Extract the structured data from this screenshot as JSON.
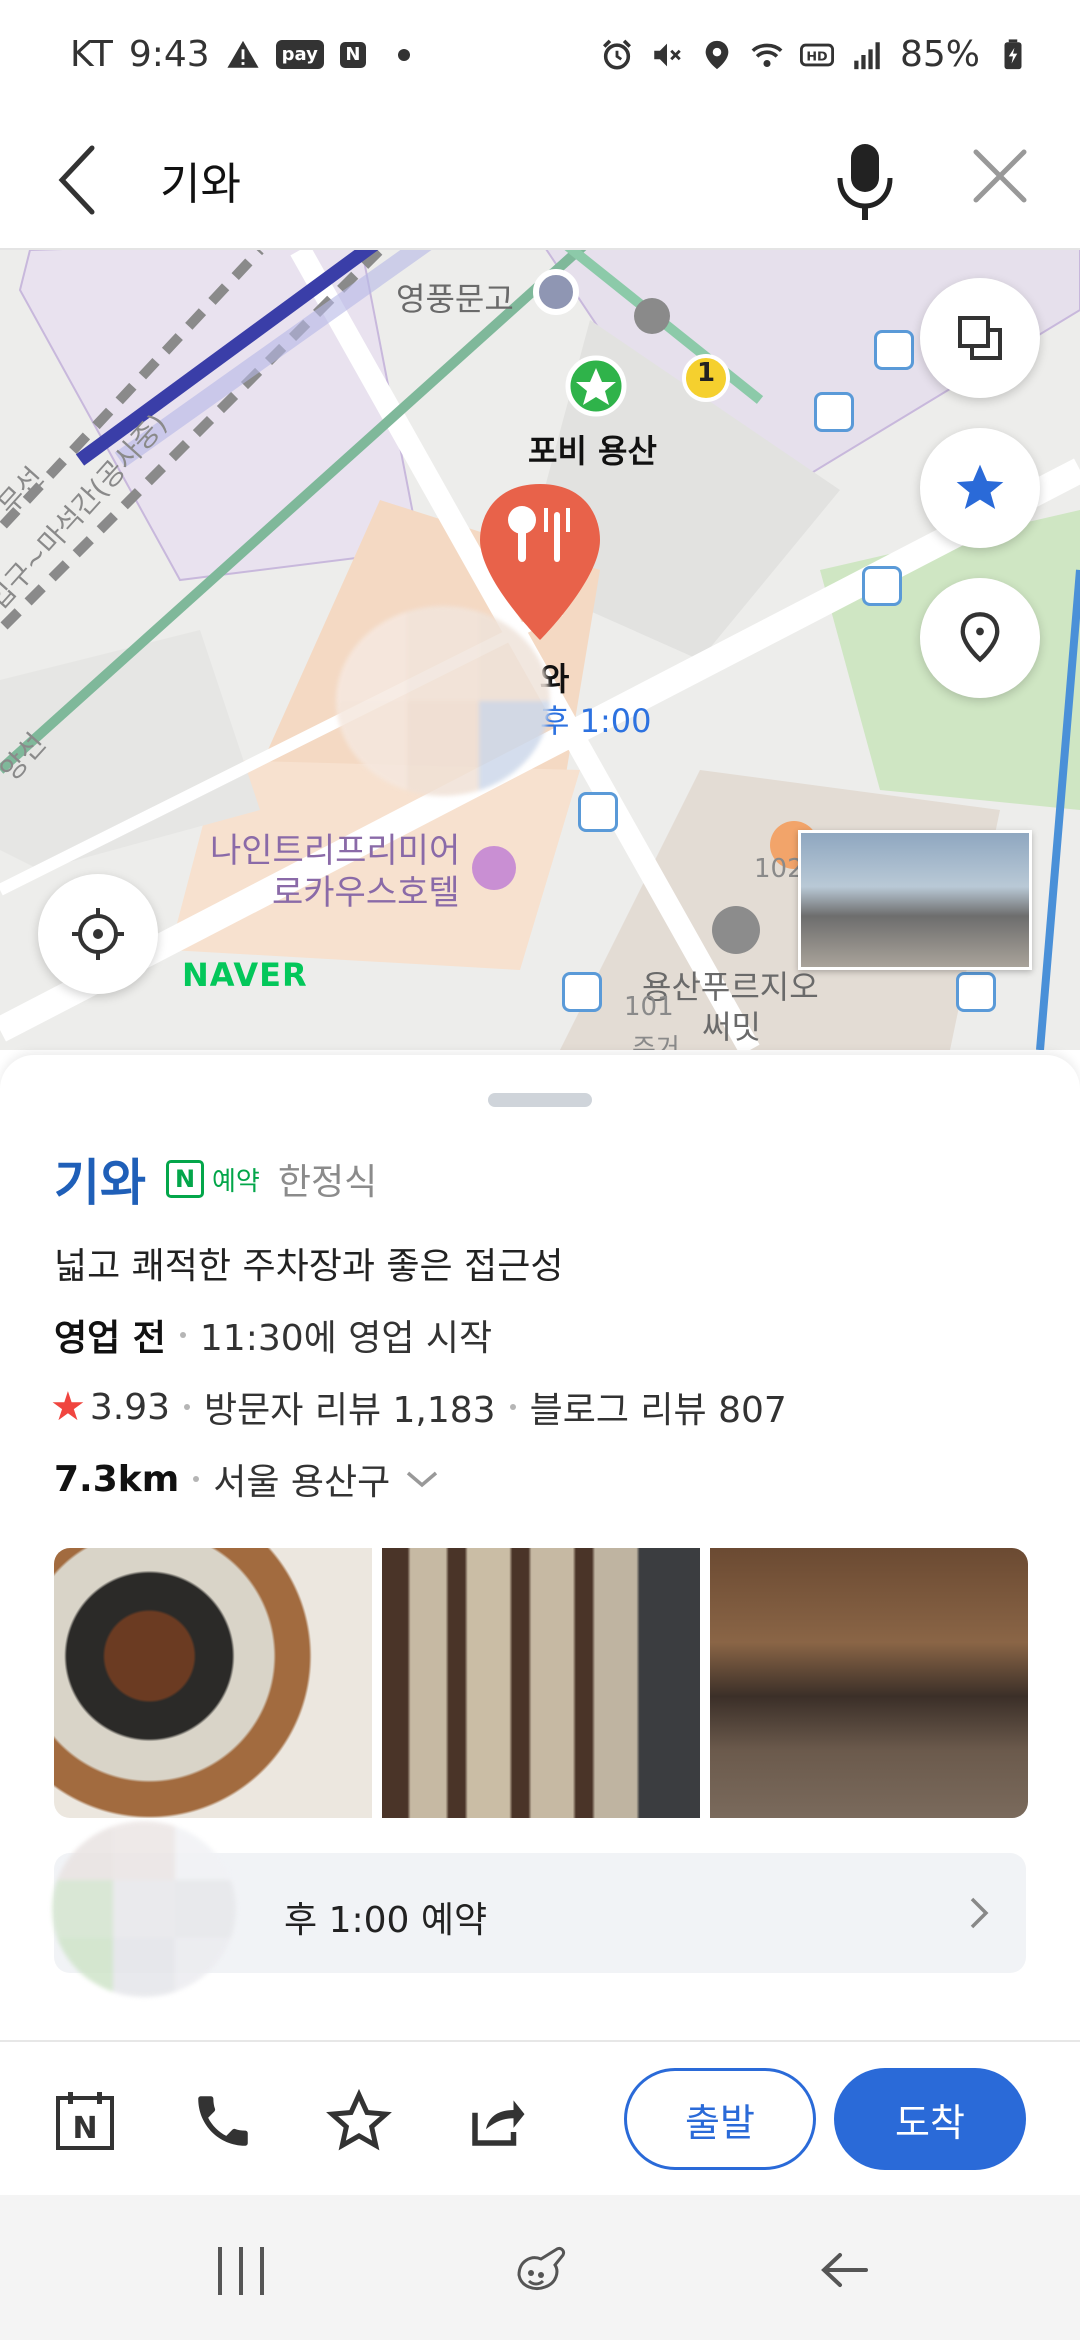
{
  "status_bar": {
    "carrier": "KT",
    "time": "9:43",
    "pay_badge": "pay",
    "n_badge": "N",
    "battery": "85%"
  },
  "search": {
    "query": "기와"
  },
  "map": {
    "labels": {
      "bookstore": "영풍문고",
      "station": "포비 용산",
      "line1": "1",
      "rail_left": "무선",
      "rail_diag": "대입구~마석간(공사중)",
      "rail_bottom": "앙선",
      "marker_name": "와",
      "marker_time": "후 1:00",
      "hotel_line1": "나인트리프리미어",
      "hotel_line2": "로카우스호텔",
      "mall_line1": "용산푸르지오",
      "mall_line2": "써밋",
      "num_102": "102",
      "num_101": "101",
      "parking": "주거"
    },
    "logo": "NAVER"
  },
  "place": {
    "name": "기와",
    "reserve_badge": "예약",
    "reserve_badge_n": "N",
    "category": "한정식",
    "description": "넓고 쾌적한 주차장과 좋은 접근성",
    "status": "영업 전",
    "open_info": "11:30에 영업 시작",
    "rating": "3.93",
    "visitor_reviews": "방문자 리뷰 1,183",
    "blog_reviews": "블로그 리뷰 807",
    "distance": "7.3km",
    "region": "서울 용산구",
    "reservation_time": "후 1:00 예약"
  },
  "actions": {
    "depart": "출발",
    "arrive": "도착",
    "reserve_n": "N"
  },
  "colors": {
    "brand_blue": "#2a6ad8",
    "place_name": "#1f5fb8",
    "naver_green": "#03c75a",
    "marker_red": "#e8624a",
    "star_red": "#f0453f"
  }
}
